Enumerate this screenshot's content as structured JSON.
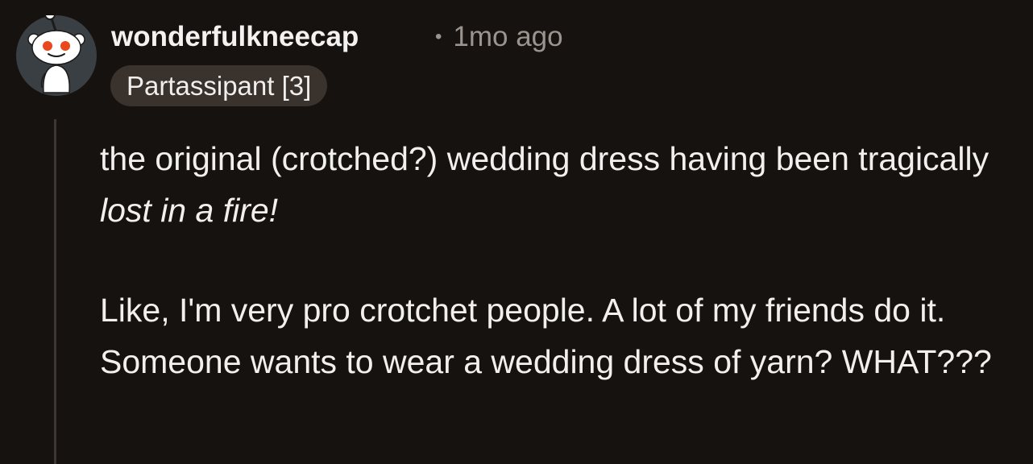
{
  "comment": {
    "author": "wonderfulkneecap",
    "separator": "•",
    "timestamp": "1mo ago",
    "flair": "Partassipant [3]",
    "paragraphs": [
      {
        "text_before": "the original (crotched?) wedding dress having been tragically ",
        "emphasis": "lost in a fire!"
      },
      {
        "text": "Like, I'm very pro crotchet people. A lot of my friends do it. Someone wants to wear a wedding dress of yarn? WHAT???"
      }
    ]
  },
  "avatar": {
    "icon": "reddit-snoo-avatar-icon"
  },
  "colors": {
    "background": "#161210",
    "text": "#f2f0ee",
    "muted": "#9b948e",
    "flair_bg": "#3a322c",
    "thread_line": "#3c3733"
  }
}
